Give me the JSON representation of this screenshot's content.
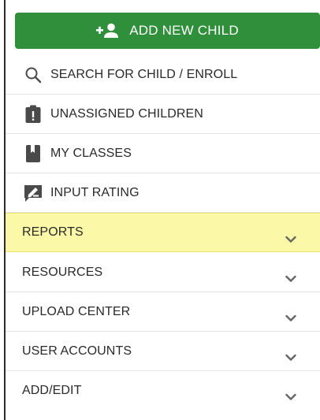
{
  "add_button": {
    "label": "ADD NEW CHILD"
  },
  "menu": {
    "search": "SEARCH FOR CHILD / ENROLL",
    "unassigned": "UNASSIGNED CHILDREN",
    "my_classes": "MY CLASSES",
    "input_rating": "INPUT RATING",
    "reports": "REPORTS",
    "resources": "RESOURCES",
    "upload_center": "UPLOAD CENTER",
    "user_accounts": "USER ACCOUNTS",
    "add_edit": "ADD/EDIT"
  },
  "colors": {
    "primary_green": "#2f8f3a",
    "highlight_yellow": "#fbf9a8",
    "icon_gray": "#4a4a4a",
    "chevron_gray": "#666666"
  },
  "icons": {
    "add": "person-add-icon",
    "search": "search-icon",
    "unassigned": "clipboard-alert-icon",
    "classes": "book-icon",
    "rating": "edit-rating-icon",
    "expand": "chevron-down-icon"
  }
}
